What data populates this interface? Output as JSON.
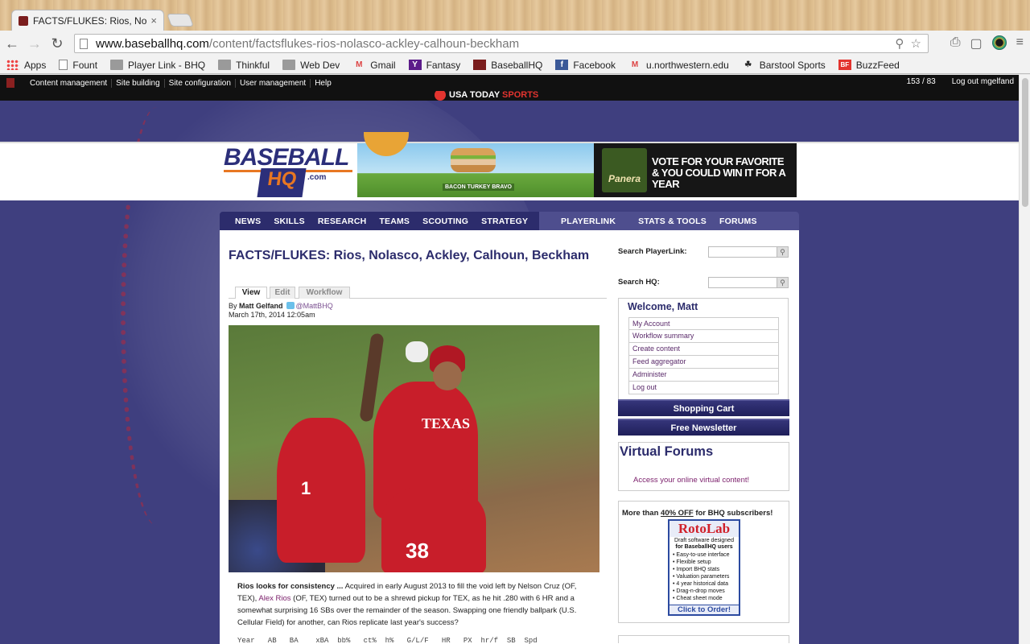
{
  "browser": {
    "tab_title": "FACTS/FLUKES: Rios, Nola",
    "tab_close": "×",
    "url_host": "www.baseballhq.com",
    "url_path": "/content/factsflukes-rios-nolasco-ackley-calhoun-beckham",
    "bookmarks": [
      {
        "label": "Apps",
        "icon": "apps-icon"
      },
      {
        "label": "Fount",
        "icon": "page-icon"
      },
      {
        "label": "Player Link - BHQ",
        "icon": "folder-icon"
      },
      {
        "label": "Thinkful",
        "icon": "folder-icon"
      },
      {
        "label": "Web Dev",
        "icon": "folder-icon"
      },
      {
        "label": "Gmail",
        "icon": "gmail-icon"
      },
      {
        "label": "Fantasy",
        "icon": "yahoo-icon"
      },
      {
        "label": "BaseballHQ",
        "icon": "baseballhq-icon"
      },
      {
        "label": "Facebook",
        "icon": "facebook-icon"
      },
      {
        "label": "u.northwestern.edu",
        "icon": "gmail-icon"
      },
      {
        "label": "Barstool Sports",
        "icon": "barstool-icon"
      },
      {
        "label": "BuzzFeed",
        "icon": "buzzfeed-icon"
      }
    ]
  },
  "admin": {
    "items": [
      "Content management",
      "Site building",
      "Site configuration",
      "User management",
      "Help"
    ],
    "counter": "153 / 83",
    "logout": "Log out mgelfand"
  },
  "header": {
    "usa_today": "USA TODAY",
    "usa_sports": "SPORTS",
    "logo_top": "BASEBALL",
    "logo_hq": "HQ",
    "logo_com": ".com",
    "ad_caption": "BACON TURKEY BRAVO",
    "ad_brand": "Panera",
    "ad_line1": "VOTE FOR YOUR FAVORITE",
    "ad_line2": "& YOU COULD WIN IT FOR A YEAR"
  },
  "nav": {
    "left": [
      "NEWS",
      "SKILLS",
      "RESEARCH",
      "TEAMS",
      "SCOUTING",
      "STRATEGY"
    ],
    "right": [
      "PLAYERLINK",
      "STATS & TOOLS",
      "FORUMS"
    ]
  },
  "article": {
    "title": "FACTS/FLUKES: Rios, Nolasco, Ackley, Calhoun, Beckham",
    "tabs": [
      "View",
      "Edit",
      "Workflow"
    ],
    "by": "By",
    "author": "Matt Gelfand",
    "handle": "@MattBHQ",
    "date": "March 17th, 2014 12:05am",
    "photo": {
      "jersey": "TEXAS",
      "number1": "1",
      "number2": "38"
    },
    "lead_bold": "Rios looks for consistency ...",
    "lead_1": " Acquired in early August 2013 to fill the void left by Nelson Cruz (OF, TEX), ",
    "lead_link": "Alex Rios",
    "lead_2": " (OF, TEX) turned out to be a shrewd pickup for TEX, as he hit .280 with 6 HR and a somewhat surprising 16 SBs over the remainder of the season. Swapping one friendly ballpark (U.S. Cellular Field) for another, can Rios replicate last year's success?",
    "table_header": "Year   AB   BA    xBA  bb%   ct%  h%   G/L/F   HR   PX  hr/f  SB  Spd"
  },
  "sidebar": {
    "search_playerlink_label": "Search PlayerLink:",
    "search_hq_label": "Search HQ:",
    "welcome_title": "Welcome, Matt",
    "links": [
      "My Account",
      "Workflow summary",
      "Create content",
      "Feed aggregator",
      "Administer",
      "Log out"
    ],
    "shopping_cart": "Shopping Cart",
    "newsletter": "Free Newsletter",
    "forums_title": "Virtual Forums",
    "forums_link": "Access your online virtual content!",
    "promo_pre": "More than ",
    "promo_off": "40% OFF",
    "promo_post": " for BHQ subscribers!",
    "rotolab_title": "RotoLab",
    "rotolab_sub1": "Draft software designed",
    "rotolab_sub2": "for BaseballHQ users",
    "rotolab_features": [
      "Easy-to-use interface",
      "Flexible setup",
      "Import BHQ stats",
      "Valuation parameters",
      "4 year historical data",
      "Drag-n-drop moves",
      "Cheat sheet mode"
    ],
    "rotolab_order": "Click to Order!"
  }
}
